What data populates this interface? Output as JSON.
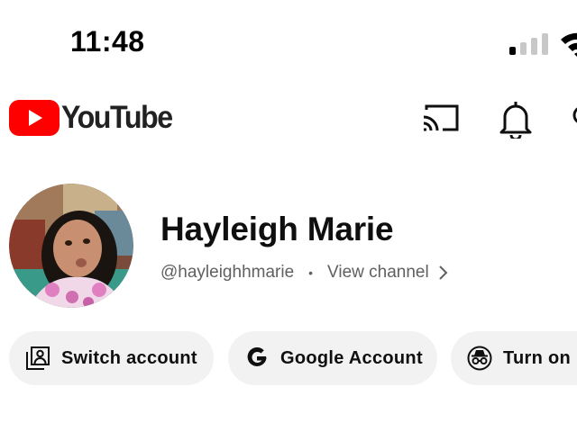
{
  "status_bar": {
    "time": "11:48",
    "signal_bars_on": 1,
    "signal_bars_total": 4
  },
  "header": {
    "logo_text": "YouTube",
    "icons": [
      "cast-icon",
      "bell-icon",
      "search-icon"
    ],
    "brand_red": "#FF0000"
  },
  "profile": {
    "name": "Hayleigh Marie",
    "handle": "@hayleighhmarie",
    "separator": "•",
    "view_channel_label": "View channel"
  },
  "chips": {
    "switch_account": "Switch account",
    "google_account": "Google Account",
    "incognito": "Turn on In"
  }
}
